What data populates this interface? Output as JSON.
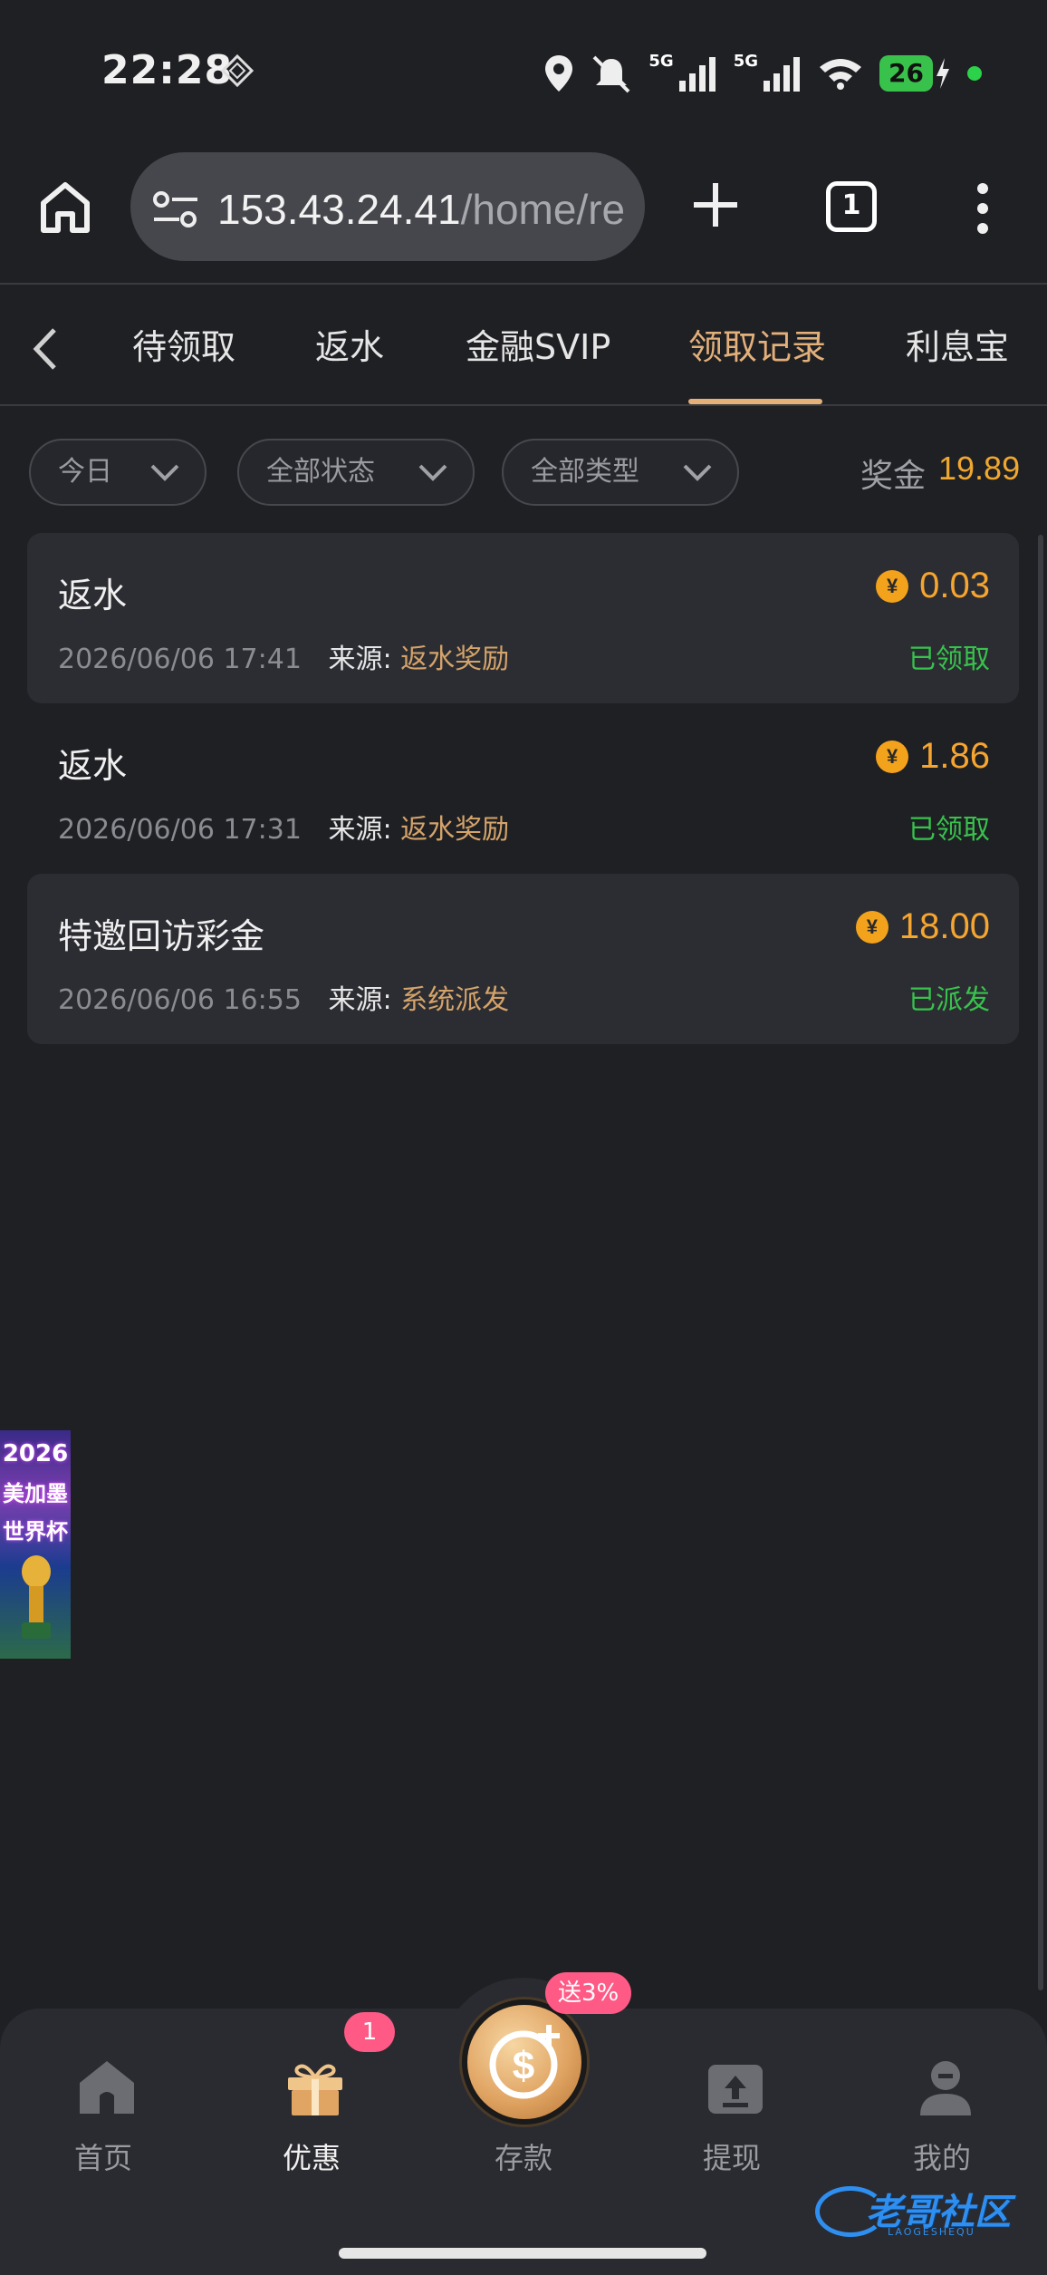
{
  "status_bar": {
    "time": "22:28",
    "signal_1": "5G",
    "signal_2": "5G",
    "battery": "26"
  },
  "browser": {
    "url_host": "153.43.24.41",
    "url_path": "/home/re",
    "tab_count": "1"
  },
  "tabs": [
    {
      "label": "待领取"
    },
    {
      "label": "返水"
    },
    {
      "label": "金融SVIP"
    },
    {
      "label": "领取记录"
    },
    {
      "label": "利息宝"
    }
  ],
  "active_tab": "领取记录",
  "filters": {
    "date": "今日",
    "status": "全部状态",
    "type": "全部类型"
  },
  "bonus": {
    "label": "奖金",
    "value": "19.89"
  },
  "currency_symbol": "¥",
  "source_label": "来源:",
  "records": [
    {
      "title": "返水",
      "amount": "0.03",
      "datetime": "2026/06/06 17:41",
      "source": "返水奖励",
      "status": "已领取"
    },
    {
      "title": "返水",
      "amount": "1.86",
      "datetime": "2026/06/06 17:31",
      "source": "返水奖励",
      "status": "已领取"
    },
    {
      "title": "特邀回访彩金",
      "amount": "18.00",
      "datetime": "2026/06/06 16:55",
      "source": "系统派发",
      "status": "已派发"
    }
  ],
  "float_banner": {
    "line1": "2026",
    "line2": "美加墨",
    "line3": "世界杯"
  },
  "bottom_nav": {
    "home": "首页",
    "promo": "优惠",
    "promo_badge": "1",
    "deposit": "存款",
    "deposit_badge": "送3%",
    "withdraw": "提现",
    "mine": "我的"
  },
  "watermark": {
    "text": "老哥社区",
    "sub": "LAOGESHEQU"
  },
  "colors": {
    "accent": "#e3b07a",
    "amount": "#f5a530",
    "status_green": "#38c24d",
    "background": "#1f2024",
    "card": "#2c2d32"
  }
}
